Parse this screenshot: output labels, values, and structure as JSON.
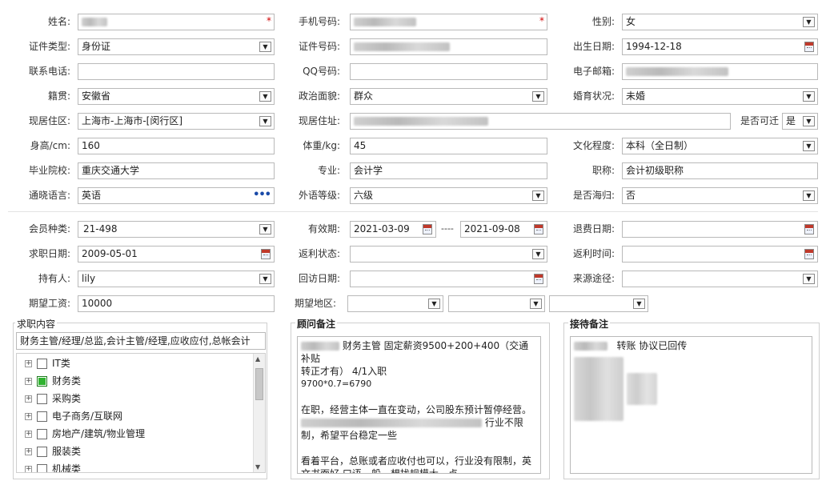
{
  "row1": {
    "name_label": "姓名:",
    "phone_label": "手机号码:",
    "gender_label": "性别:",
    "gender_value": "女",
    "required_mark": "*"
  },
  "row2": {
    "idtype_label": "证件类型:",
    "idtype_value": "身份证",
    "idno_label": "证件号码:",
    "birth_label": "出生日期:",
    "birth_value": "1994-12-18"
  },
  "row3": {
    "contact_label": "联系电话:",
    "qq_label": "QQ号码:",
    "email_label": "电子邮箱:"
  },
  "row4": {
    "native_label": "籍贯:",
    "native_value": "安徽省",
    "political_label": "政治面貌:",
    "political_value": "群众",
    "marital_label": "婚育状况:",
    "marital_value": "未婚"
  },
  "row5": {
    "area_label": "现居住区:",
    "area_value": "上海市-上海市-[闵行区]",
    "address_label": "现居住址:",
    "relocate_label": "是否可迁",
    "relocate_value": "是"
  },
  "row6": {
    "height_label": "身高/cm:",
    "height_value": "160",
    "weight_label": "体重/kg:",
    "weight_value": "45",
    "edu_label": "文化程度:",
    "edu_value": "本科（全日制）"
  },
  "row7": {
    "school_label": "毕业院校:",
    "school_value": "重庆交通大学",
    "major_label": "专业:",
    "major_value": "会计学",
    "title_label": "职称:",
    "title_value": "会计初级职称"
  },
  "row8": {
    "lang_label": "通晓语言:",
    "lang_value": "英语",
    "lang_more": "•••",
    "level_label": "外语等级:",
    "level_value": "六级",
    "returnee_label": "是否海归:",
    "returnee_value": "否"
  },
  "row9": {
    "member_label": "会员种类:",
    "member_value": "21-498",
    "valid_label": "有效期:",
    "valid_from": "2021-03-09",
    "valid_sep": "----",
    "valid_to": "2021-09-08",
    "refund_label": "退费日期:"
  },
  "row10": {
    "jobdate_label": "求职日期:",
    "jobdate_value": "2009-05-01",
    "rebate_state_label": "返利状态:",
    "rebate_time_label": "返利时间:"
  },
  "row11": {
    "holder_label": "持有人:",
    "holder_value": "lily",
    "visit_label": "回访日期:",
    "source_label": "来源途径:"
  },
  "row12": {
    "salary_label": "期望工资:",
    "salary_value": "10000",
    "region_label": "期望地区:"
  },
  "job": {
    "title": "求职内容",
    "summary": "财务主管/经理/总监,会计主管/经理,应收应付,总帐会计",
    "items": [
      {
        "label": "IT类",
        "checked": false
      },
      {
        "label": "财务类",
        "checked": true
      },
      {
        "label": "采购类",
        "checked": false
      },
      {
        "label": "电子商务/互联网",
        "checked": false
      },
      {
        "label": "房地产/建筑/物业管理",
        "checked": false
      },
      {
        "label": "服装类",
        "checked": false
      },
      {
        "label": "机械类",
        "checked": false
      }
    ]
  },
  "advisor": {
    "title": "顾问备注",
    "line1": "财务主管 固定薪资9500+200+400（交通补贴",
    "line2": "转正才有）   4/1入职",
    "line3": "9700*0.7=6790",
    "line4": "在职，经营主体一直在变动，公司股东预计暂停经营。",
    "line5": "行业不限",
    "line6": "制，希望平台稳定一些",
    "line7": "看着平台，总账或者应收付也可以，行业没有限制，英",
    "line8": "文书面好 口语一般，想找规模大一点"
  },
  "reception": {
    "title": "接待备注",
    "line1": "转账   协议已回传"
  }
}
